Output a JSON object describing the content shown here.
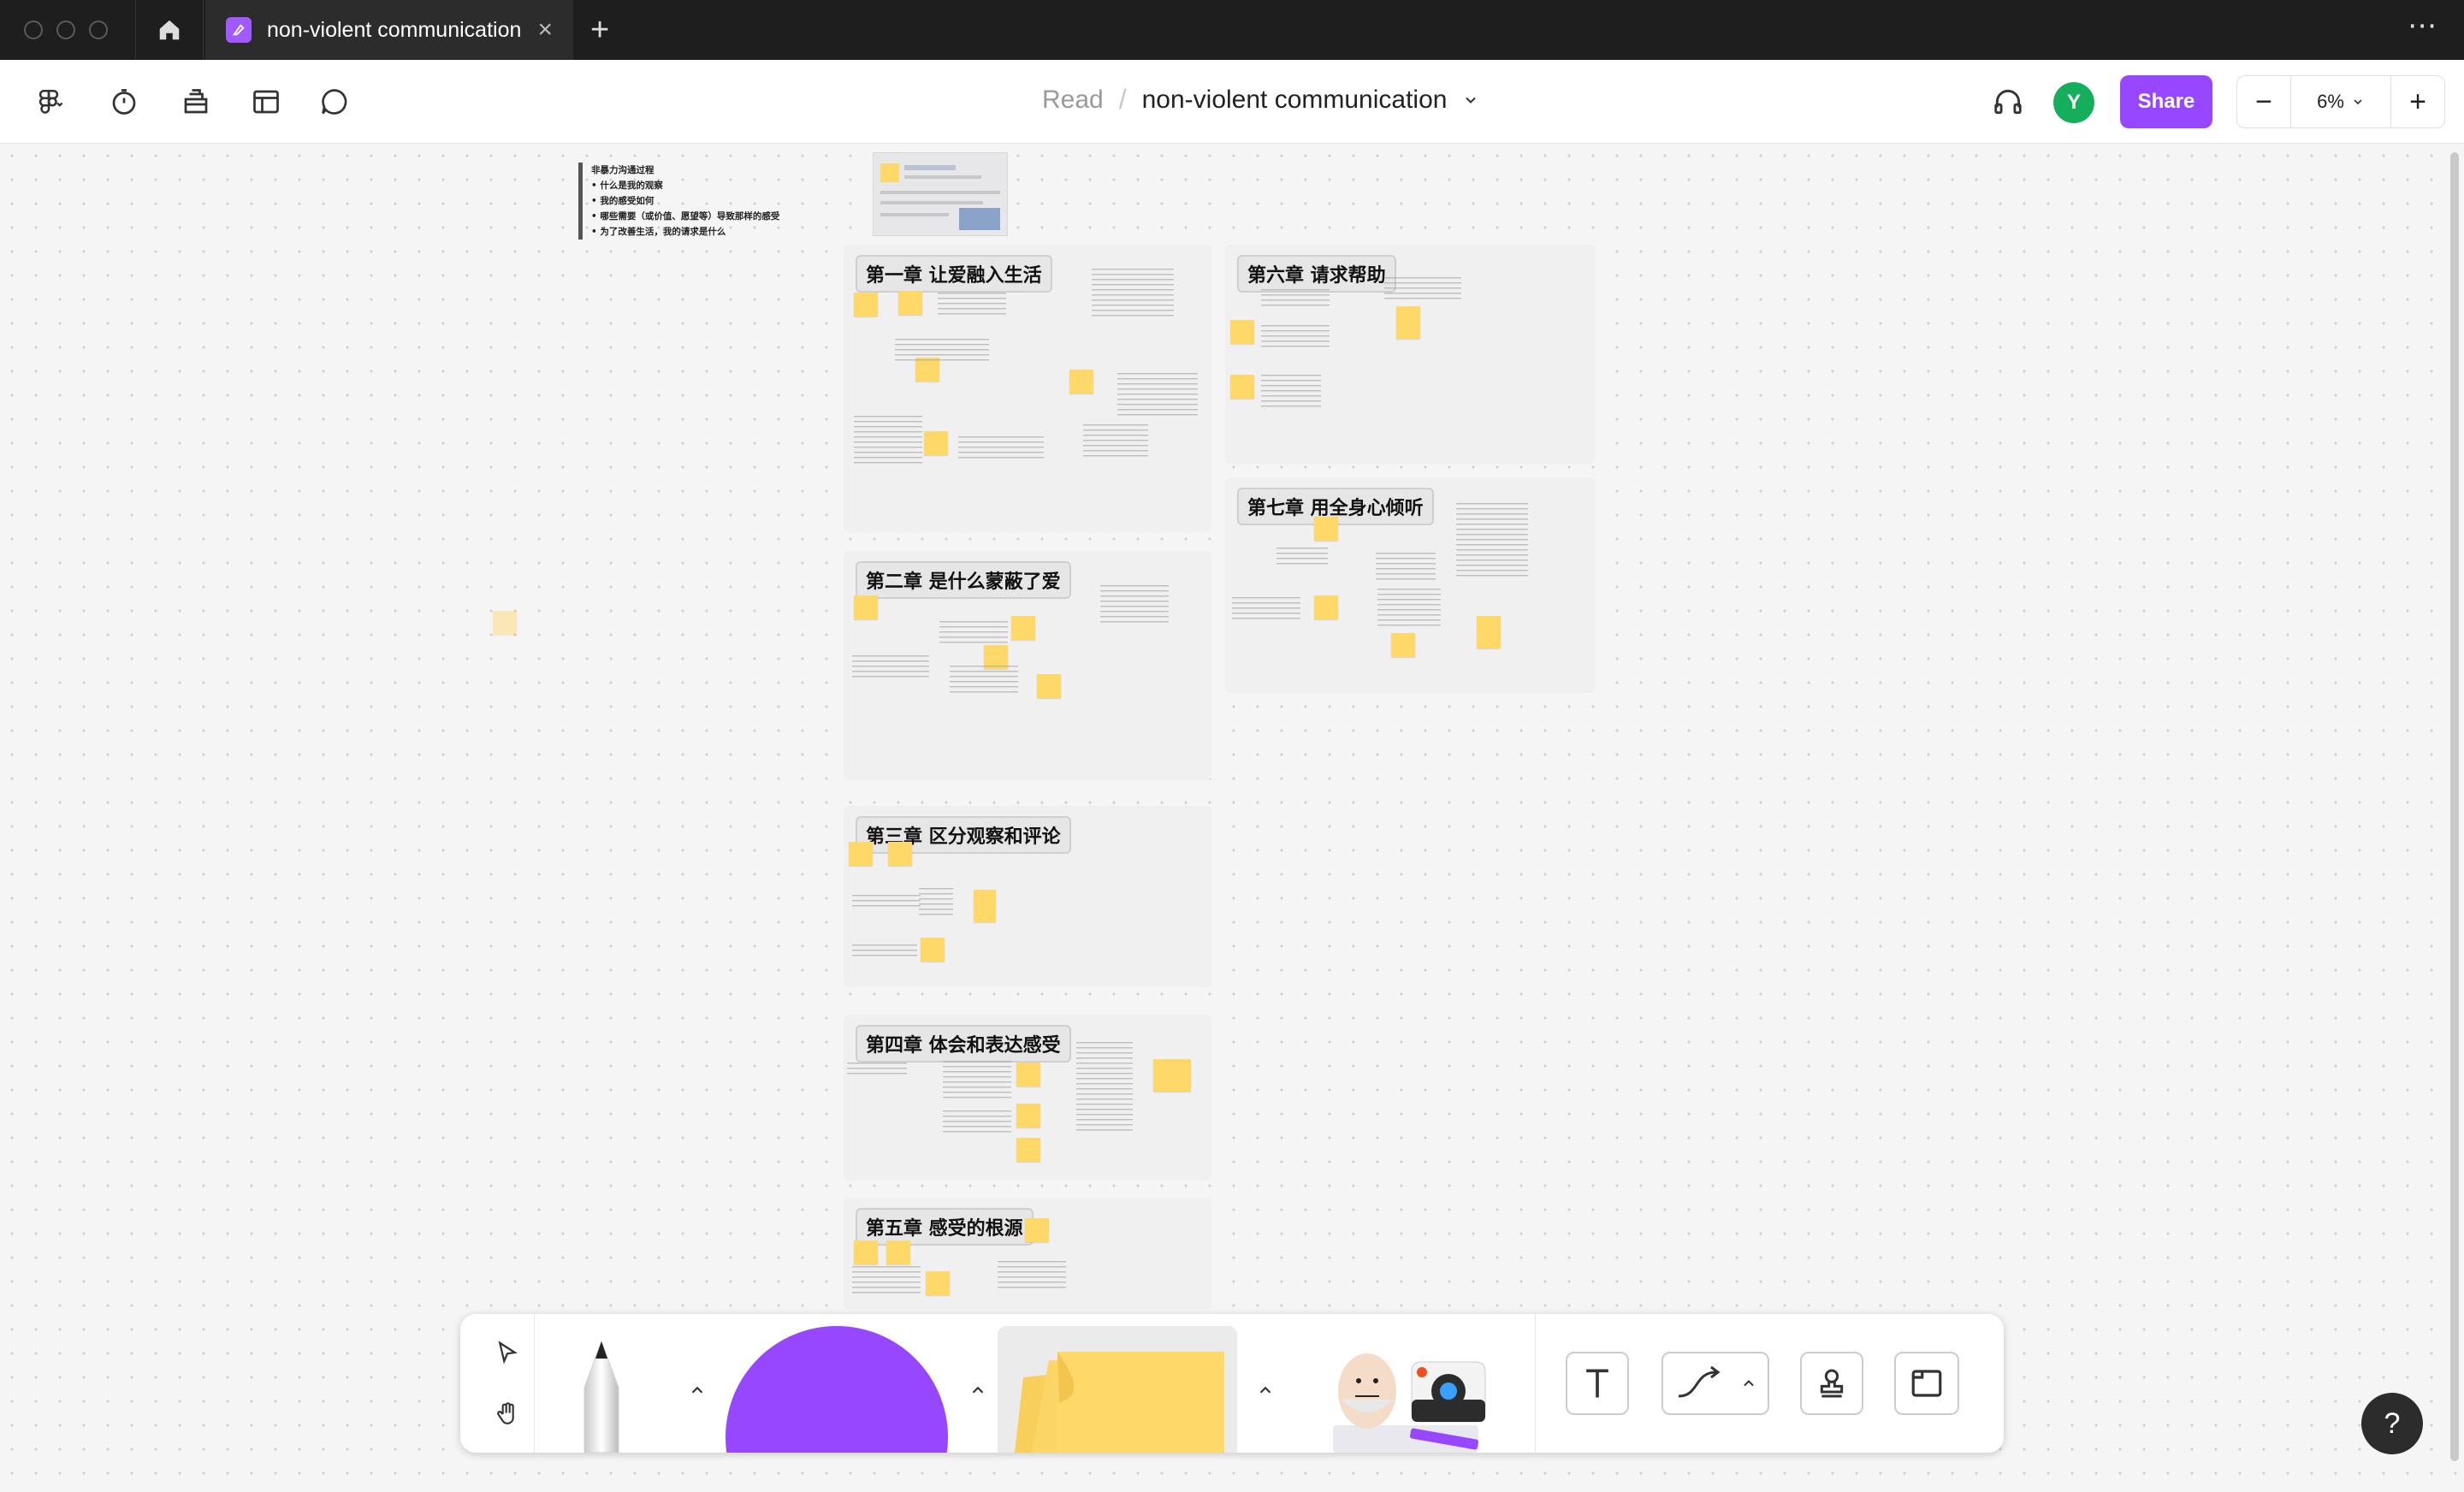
{
  "window": {
    "tab_title": "non-violent communication",
    "tab_close": "×",
    "new_tab": "+",
    "more": "⋯"
  },
  "toolbar": {
    "breadcrumb_parent": "Read",
    "breadcrumb_sep": "/",
    "file_name": "non-violent communication",
    "avatar_initial": "Y",
    "share_label": "Share",
    "zoom_out": "−",
    "zoom_level": "6%",
    "zoom_in": "+"
  },
  "canvas": {
    "summary_lines": [
      "非暴力沟通过程",
      "• 什么是我的观察",
      "• 我的感受如何",
      "• 哪些需要（或价值、愿望等）导致那样的感受",
      "• 为了改善生活，我的请求是什么"
    ],
    "sections": [
      {
        "title": "第一章 让爱融入生活"
      },
      {
        "title": "第二章 是什么蒙蔽了爱"
      },
      {
        "title": "第三章 区分观察和评论"
      },
      {
        "title": "第四章 体会和表达感受"
      },
      {
        "title": "第五章 感受的根源"
      },
      {
        "title": "第六章 请求帮助"
      },
      {
        "title": "第七章 用全身心倾听"
      }
    ]
  },
  "dock": {
    "tools": [
      "move-tool",
      "hand-tool",
      "pencil-tool",
      "shape-tool",
      "sticky-note-tool",
      "stickers-tool",
      "text-tool",
      "connector-tool",
      "stamp-tool",
      "section-tool"
    ]
  },
  "help_label": "?",
  "colors": {
    "accent": "#9747ff",
    "sticky": "#ffd86a",
    "avatar": "#14ae5c",
    "titlebar": "#1e1e1e"
  }
}
